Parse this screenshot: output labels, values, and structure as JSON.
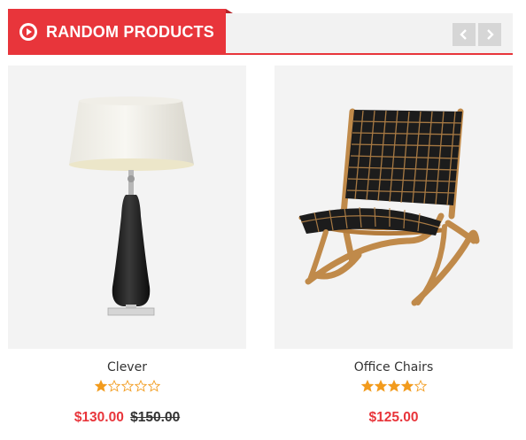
{
  "module": {
    "title": "RANDOM PRODUCTS",
    "icon": "play-circle-icon",
    "accent_color": "#e8353b"
  },
  "navigation": {
    "prev_icon": "chevron-left-icon",
    "next_icon": "chevron-right-icon"
  },
  "products": [
    {
      "name": "Clever",
      "image": "table-lamp",
      "rating": 1,
      "max_rating": 5,
      "price": "$130.00",
      "old_price": "$150.00"
    },
    {
      "name": "Office Chairs",
      "image": "woven-folding-chair",
      "rating": 4,
      "max_rating": 5,
      "price": "$125.00",
      "old_price": ""
    }
  ],
  "colors": {
    "star_filled": "#f29b1d",
    "price": "#e8353b",
    "image_bg": "#f3f3f3"
  }
}
